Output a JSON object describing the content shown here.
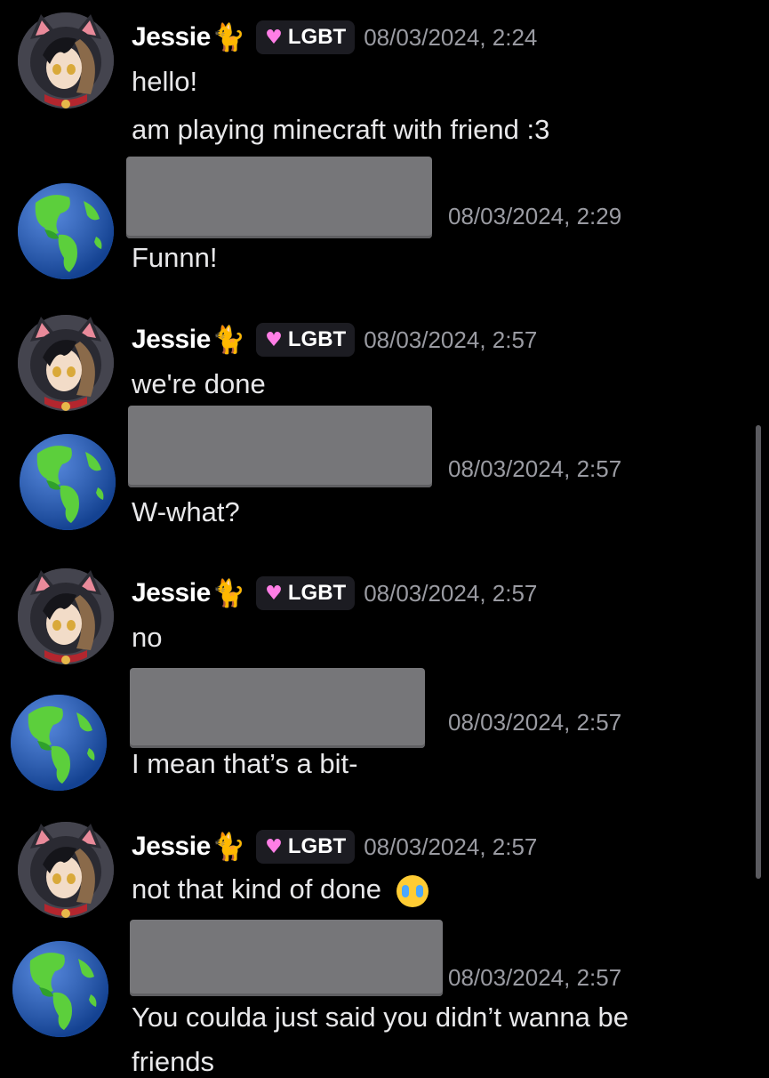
{
  "messages": [
    {
      "author": "Jessie",
      "role": "LGBT",
      "timestamp": "08/03/2024, 2:24",
      "lines": [
        "hello!",
        "am playing minecraft with friend :3"
      ]
    },
    {
      "author": "",
      "timestamp": "08/03/2024, 2:29",
      "lines": [
        "Funnn!"
      ]
    },
    {
      "author": "Jessie",
      "role": "LGBT",
      "timestamp": "08/03/2024, 2:57",
      "lines": [
        "we're done"
      ]
    },
    {
      "author": "",
      "timestamp": "08/03/2024, 2:57",
      "lines": [
        "W-what?"
      ]
    },
    {
      "author": "Jessie",
      "role": "LGBT",
      "timestamp": "08/03/2024, 2:57",
      "lines": [
        "no"
      ]
    },
    {
      "author": "",
      "timestamp": "08/03/2024, 2:57",
      "lines": [
        "I mean that’s a bit-"
      ]
    },
    {
      "author": "Jessie",
      "role": "LGBT",
      "timestamp": "08/03/2024, 2:57",
      "lines": [
        "not that kind of done"
      ]
    },
    {
      "author": "",
      "timestamp": "08/03/2024, 2:57",
      "lines": [
        "You coulda just said you didn’t wanna be",
        "friends"
      ]
    }
  ],
  "icons": {
    "jessie_avatar": "cat-avatar-icon",
    "other_avatar": "earth-avatar-icon",
    "name_emoji": "black-cat-icon",
    "role_icon": "pink-heart-icon",
    "reaction_emoji": "crying-face-icon"
  },
  "colors": {
    "background": "#000000",
    "username": "#ffffff",
    "timestamp": "#9a9ba2",
    "role_heart": "#ff7ee6",
    "redaction": "#767679"
  }
}
